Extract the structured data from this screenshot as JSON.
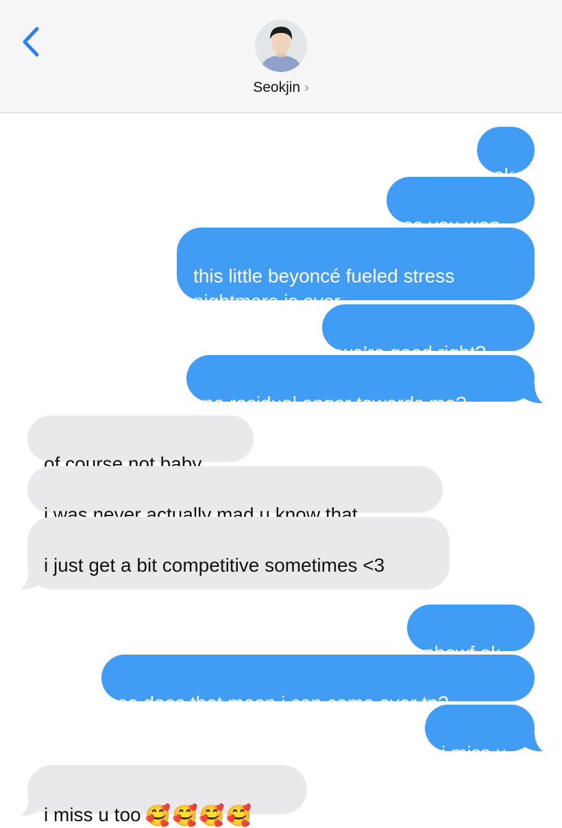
{
  "header": {
    "contact_name": "Seokjin",
    "chevron": "›"
  },
  "colors": {
    "outgoing": "#419cf3",
    "incoming": "#e9e9ec",
    "back_icon": "#2c7ff4"
  },
  "icons": [
    "back-chevron-icon",
    "contact-avatar",
    "smiling-face-with-hearts-icon"
  ],
  "messages": [
    {
      "from": "me",
      "text": "ok"
    },
    {
      "from": "me",
      "text": "so you won"
    },
    {
      "from": "me",
      "text": "this little beyoncé fueled stress nightmare is over"
    },
    {
      "from": "me",
      "text": "we’re good right?"
    },
    {
      "from": "me",
      "text": "no residual anger towards me?"
    },
    {
      "from": "them",
      "text": "of course not baby"
    },
    {
      "from": "them",
      "text": "i was never actually mad u know that"
    },
    {
      "from": "them",
      "text": "i just get a bit competitive sometimes <3"
    },
    {
      "from": "me",
      "text": "phewf ok"
    },
    {
      "from": "me",
      "text": "so does that mean i can come over tn?"
    },
    {
      "from": "me",
      "text": "i miss u"
    },
    {
      "from": "them",
      "text": "i miss u too",
      "emoji": "🥰🥰🥰🥰"
    }
  ]
}
